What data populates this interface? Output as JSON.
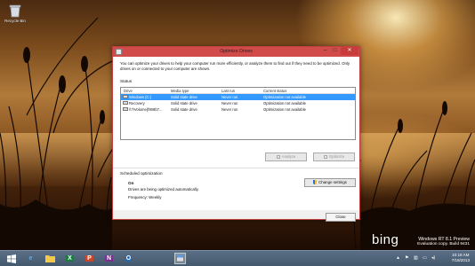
{
  "desktop": {
    "recycle_bin_label": "Recycle Bin"
  },
  "window": {
    "title": "Optimize Drives",
    "intro": "You can optimize your drives to help your computer run more efficiently, or analyze them to find out if they need to be optimized. Only drives on or connected to your computer are shown.",
    "status_label": "Status",
    "columns": [
      "Drive",
      "Media type",
      "Last run",
      "Current status"
    ],
    "drives": [
      {
        "drive": "Windows (C:)",
        "media": "Solid state drive",
        "last_run": "Never run",
        "status": "Optimization not available",
        "selected": true
      },
      {
        "drive": "Recovery",
        "media": "Solid state drive",
        "last_run": "Never run",
        "status": "Optimization not available",
        "selected": false
      },
      {
        "drive": "\\\\?\\Volume{f908b7...",
        "media": "Solid state drive",
        "last_run": "Never run",
        "status": "Optimization not available",
        "selected": false
      }
    ],
    "analyze_label": "Analyze",
    "optimize_label": "Optimize",
    "scheduled_label": "Scheduled optimization",
    "on_label": "On",
    "schedule_desc": "Drives are being optimized automatically.",
    "frequency": "Frequency: Weekly",
    "change_settings_label": "Change settings",
    "close_label": "Close"
  },
  "branding": {
    "bing": "bing",
    "watermark_line1": "Windows RT 8.1 Preview",
    "watermark_line2": "Evaluation copy. Build 9431"
  },
  "taskbar": {
    "apps": [
      "start",
      "ie",
      "explorer",
      "excel",
      "powerpoint",
      "onenote",
      "outlook",
      "optimize-drives"
    ],
    "time": "10:18 AM",
    "date": "7/18/2013"
  },
  "colors": {
    "titlebar": "#d24b4b",
    "selection": "#3399ff",
    "taskbar": "#4a5e74"
  }
}
